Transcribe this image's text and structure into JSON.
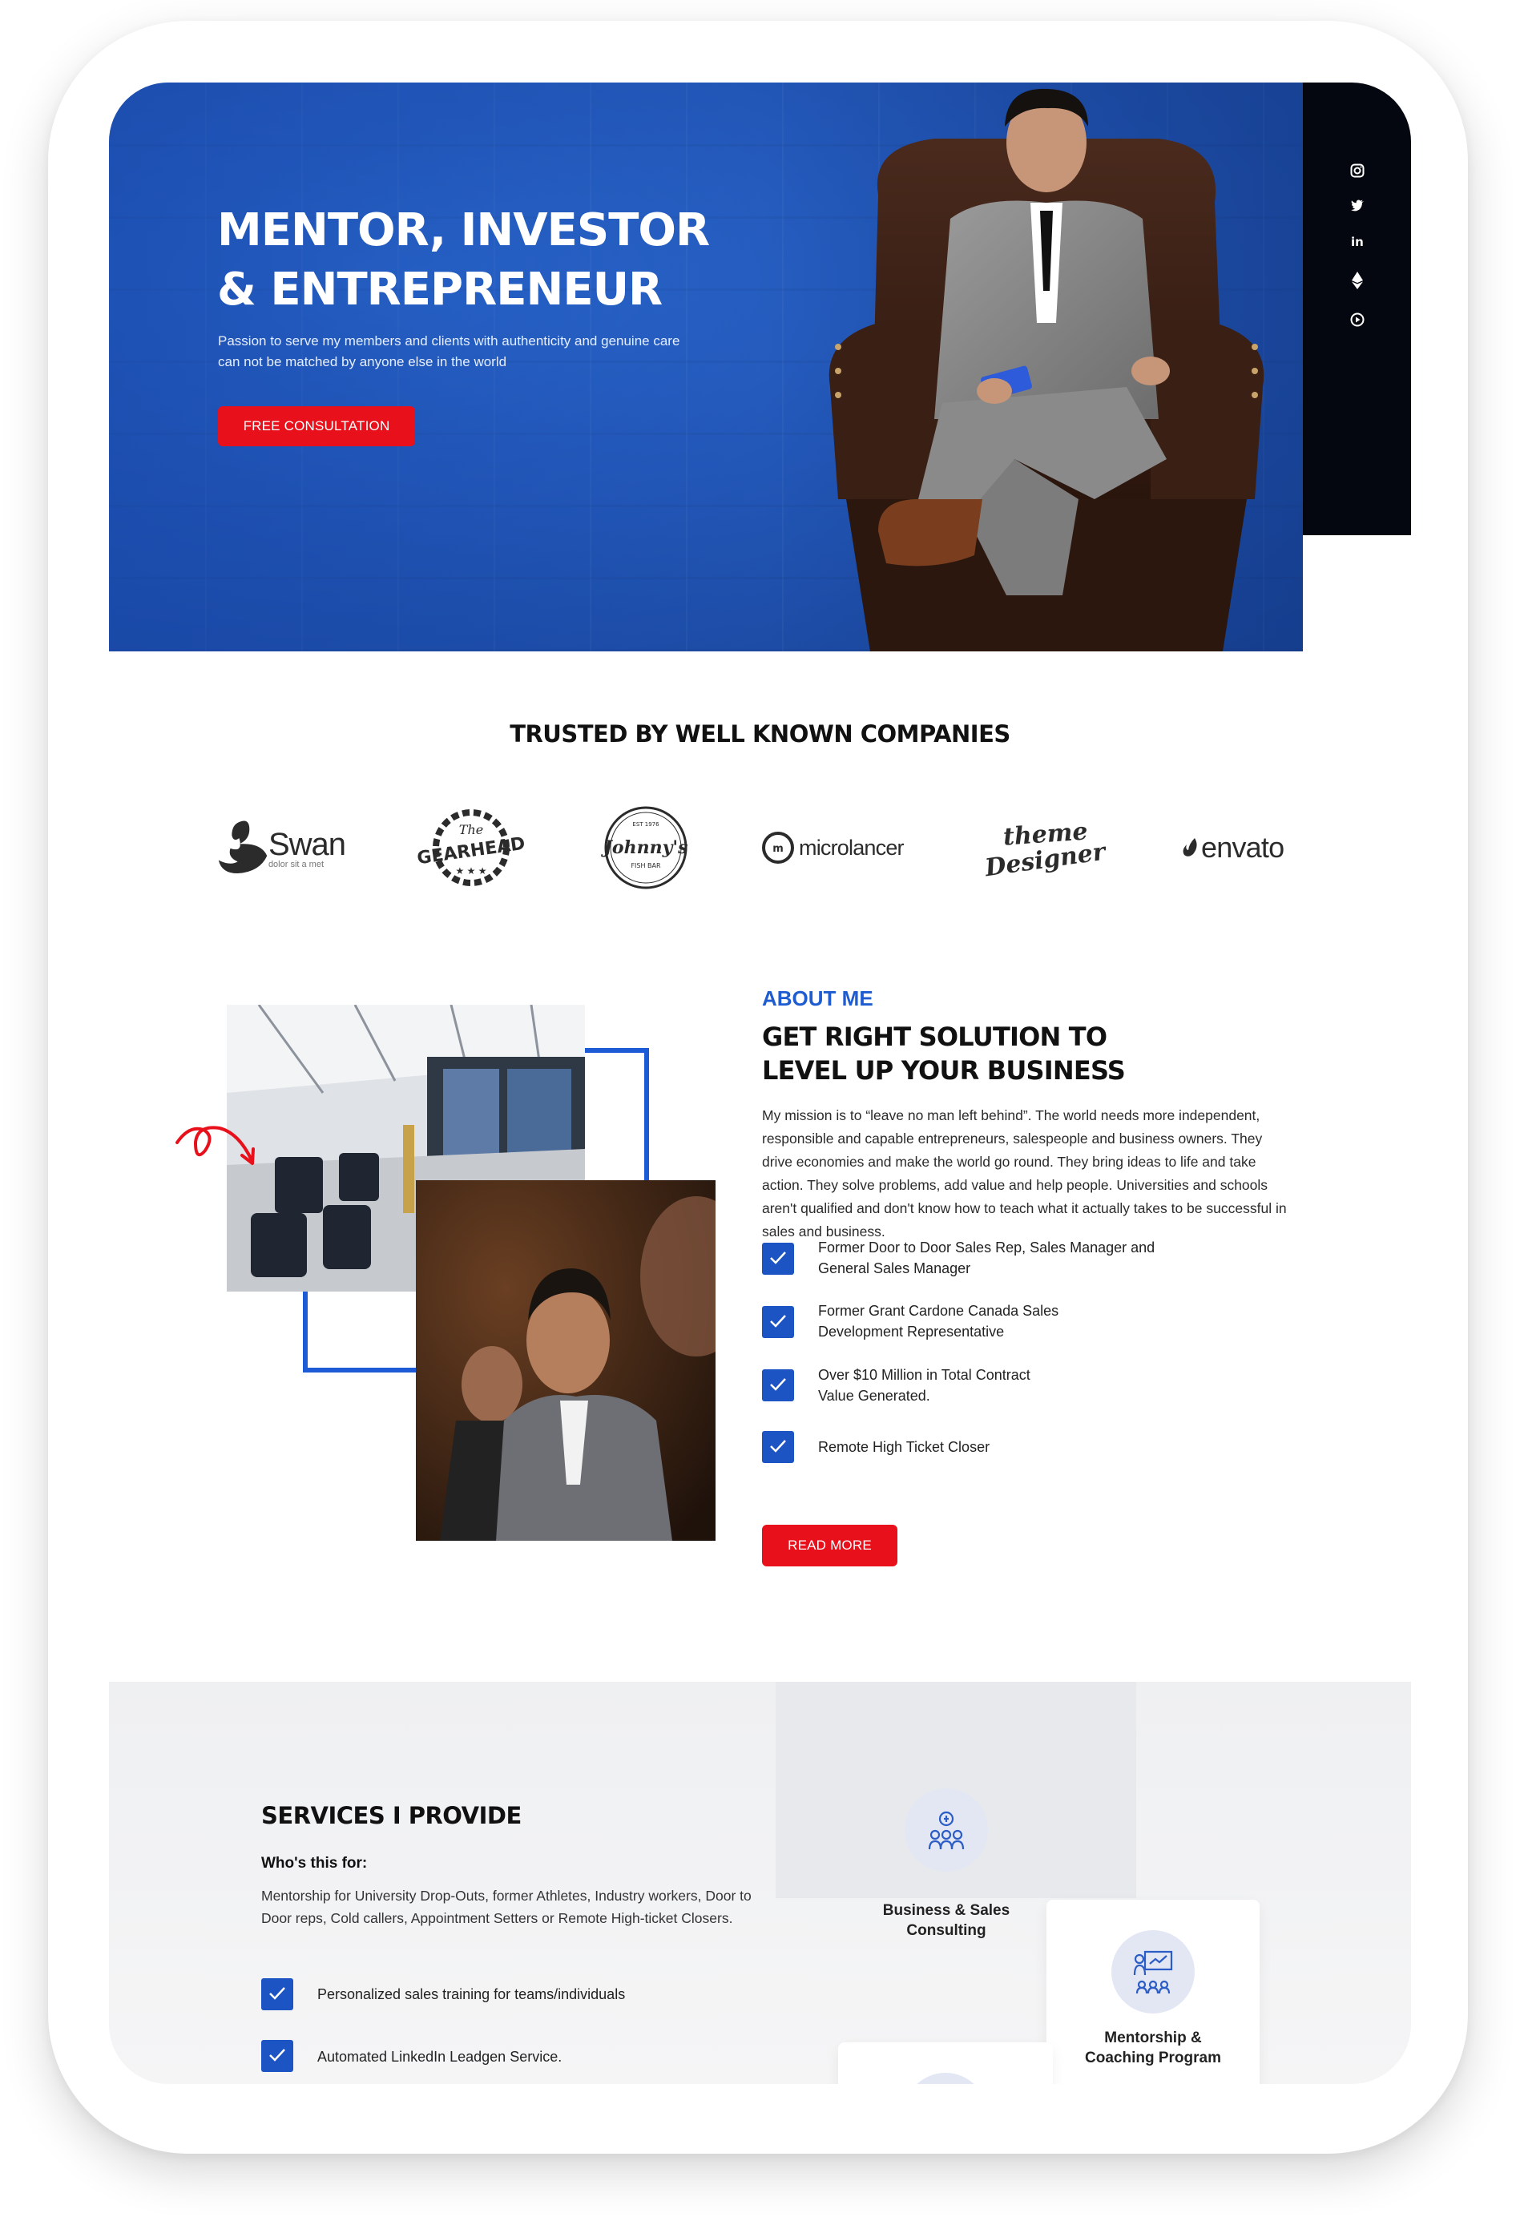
{
  "hero": {
    "title_line1": "MENTOR, INVESTOR",
    "title_line2": "& ENTREPRENEUR",
    "subtitle_line1": "Passion to serve my members and clients with authenticity and genuine care",
    "subtitle_line2": "can not be matched by anyone else in the world",
    "cta_label": "FREE CONSULTATION"
  },
  "social": [
    "instagram-icon",
    "twitter-icon",
    "linkedin-icon",
    "etherium-icon",
    "play-icon"
  ],
  "trusted": {
    "title": "TRUSTED BY WELL KNOWN COMPANIES",
    "logos": {
      "swan": "Swan",
      "swan_tag": "dolor sit a met",
      "gearhead_top": "The",
      "gearhead": "GEARHEAD",
      "johnnys_top": "EST 1976",
      "johnnys": "Johnny's",
      "johnnys_bottom": "FISH BAR",
      "microlancer": "microlancer",
      "theme_designer_1": "theme",
      "theme_designer_2": "Designer",
      "envato": "envato"
    }
  },
  "about": {
    "eyebrow": "ABOUT ME",
    "title_line1": "GET RIGHT SOLUTION TO",
    "title_line2": "LEVEL UP YOUR BUSINESS",
    "paragraph": "My mission is to “leave no man left behind”. The world needs more independent, responsible and capable entrepreneurs, salespeople and business owners. They drive economies and make the world go round. They bring ideas to life and take action. They solve problems, add value and help people. Universities and schools aren't qualified and don't know how to teach what it actually takes to be successful in sales and business.",
    "checks": [
      {
        "line1": "Former Door to Door Sales Rep, Sales Manager and",
        "line2": "General Sales Manager"
      },
      {
        "line1": "Former Grant Cardone Canada Sales",
        "line2": "Development Representative"
      },
      {
        "line1": "Over $10 Million in Total Contract",
        "line2": "Value Generated."
      },
      {
        "line1": "Remote High Ticket Closer",
        "line2": ""
      }
    ],
    "cta_label": "READ MORE"
  },
  "services": {
    "title": "SERVICES I PROVIDE",
    "who_label": "Who's this for:",
    "who_text": "Mentorship for University Drop-Outs, former Athletes, Industry workers, Door to Door reps, Cold callers, Appointment Setters or Remote High-ticket Closers.",
    "checks": [
      "Personalized sales training for teams/individuals",
      "Automated LinkedIn Leadgen Service."
    ],
    "cards": [
      {
        "line1": "Business & Sales",
        "line2": "Consulting"
      },
      {
        "line1": "Mentorship &",
        "line2": "Coaching Program"
      }
    ]
  },
  "colors": {
    "brand_blue": "#1c54c4",
    "cta_red": "#e8101a",
    "social_bar": "#04070f"
  }
}
